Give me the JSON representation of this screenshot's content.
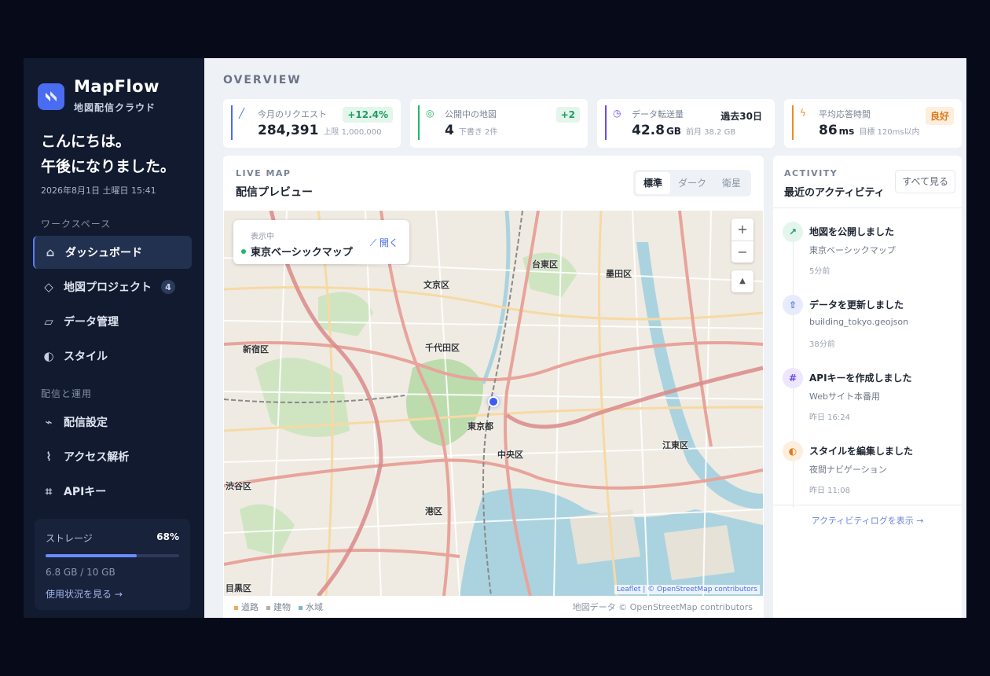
{
  "brand": {
    "name": "MapFlow",
    "subtitle": "地図配信クラウド"
  },
  "greeting": {
    "line1": "こんにちは。",
    "line2": "午後になりました。",
    "date": "2026年8月1日 土曜日 15:41"
  },
  "sidebar": {
    "section_workspace": "ワークスペース",
    "section_delivery": "配信と運用",
    "items": [
      {
        "label": "ダッシュボード",
        "icon": "home-icon",
        "active": true
      },
      {
        "label": "地図プロジェクト",
        "icon": "diamond-icon",
        "badge": "4"
      },
      {
        "label": "データ管理",
        "icon": "layers-icon"
      },
      {
        "label": "スタイル",
        "icon": "contrast-icon"
      },
      {
        "label": "配信設定",
        "icon": "signal-icon"
      },
      {
        "label": "アクセス解析",
        "icon": "pulse-icon"
      },
      {
        "label": "APIキー",
        "icon": "hash-icon"
      }
    ]
  },
  "storage": {
    "label": "ストレージ",
    "percent_text": "68%",
    "percent": 68,
    "size": "6.8 GB / 10 GB",
    "link": "使用状況を見る →"
  },
  "overview": {
    "title": "OVERVIEW",
    "stats": [
      {
        "label": "今月のリクエスト",
        "value": "284,391",
        "unit": "",
        "sub": "上限 1,000,000",
        "tag": "+12.4%",
        "color": "#4a6cf0",
        "tag_color": "#1f9d63",
        "tag_bg": "#e3f6ec"
      },
      {
        "label": "公開中の地図",
        "value": "4",
        "unit": "",
        "sub": "下書き 2件",
        "tag": "+2",
        "color": "#1fb86a",
        "tag_color": "#1f9d63",
        "tag_bg": "#e3f6ec"
      },
      {
        "label": "データ転送量",
        "value": "42.8",
        "unit": "GB",
        "sub": "前月 38.2 GB",
        "tag": "過去30日",
        "color": "#6a4cf0",
        "tag_color": "#1d2431",
        "tag_bg": "#ffffff"
      },
      {
        "label": "平均応答時間",
        "value": "86",
        "unit": "ms",
        "sub": "目標 120ms以内",
        "tag": "良好",
        "color": "#f08a24",
        "tag_color": "#e07a1a",
        "tag_bg": "#fdeedd"
      }
    ]
  },
  "map_panel": {
    "eyebrow": "LIVE MAP",
    "title": "配信プレビュー",
    "styles": [
      "標準",
      "ダーク",
      "衛星"
    ],
    "card_status": "表示中",
    "card_name": "東京ベーシックマップ",
    "card_open": "開く",
    "zoom_in": "+",
    "zoom_out": "−",
    "attribution": "Leaflet | © OpenStreetMap contributors",
    "labels": [
      "台東区",
      "墨田区",
      "文京区",
      "新宿区",
      "千代田区",
      "東京都",
      "中央区",
      "江東区",
      "渋谷区",
      "港区",
      "目黒区"
    ],
    "legend": [
      {
        "label": "道路",
        "color": "#f0a860"
      },
      {
        "label": "建物",
        "color": "#b6b0a8"
      },
      {
        "label": "水域",
        "color": "#7fb6c8"
      }
    ],
    "source": "地図データ © OpenStreetMap contributors"
  },
  "activity": {
    "eyebrow": "ACTIVITY",
    "title": "最近のアクティビティ",
    "view_all": "すべて見る",
    "items": [
      {
        "title": "地図を公開しました",
        "detail": "東京ベーシックマップ",
        "time": "5分前",
        "icon": "publish-icon",
        "color": "#1f9d63",
        "bg": "#e3f6ec",
        "glyph": "↗"
      },
      {
        "title": "データを更新しました",
        "detail": "building_tokyo.geojson",
        "time": "38分前",
        "icon": "upload-icon",
        "color": "#4a6cf0",
        "bg": "#e6ecfd",
        "glyph": "⇧"
      },
      {
        "title": "APIキーを作成しました",
        "detail": "Webサイト本番用",
        "time": "昨日 16:24",
        "icon": "hash-icon",
        "color": "#6a4cf0",
        "bg": "#ece7fd",
        "glyph": "#"
      },
      {
        "title": "スタイルを編集しました",
        "detail": "夜間ナビゲーション",
        "time": "昨日 11:08",
        "icon": "contrast-icon",
        "color": "#e07a1a",
        "bg": "#fdeedd",
        "glyph": "◐"
      }
    ],
    "log_link": "アクティビティログを表示 →"
  }
}
